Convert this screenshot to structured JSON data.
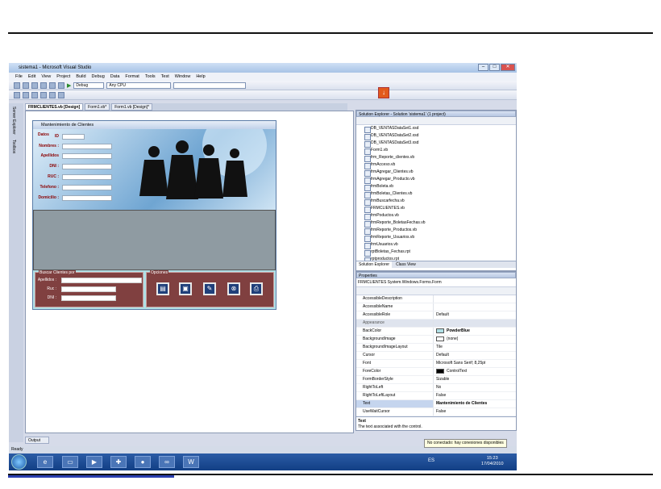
{
  "window": {
    "title": "sistema1 - Microsoft Visual Studio",
    "buttons": [
      "–",
      "□",
      "✕"
    ]
  },
  "menu": [
    "File",
    "Edit",
    "View",
    "Project",
    "Build",
    "Debug",
    "Data",
    "Format",
    "Tools",
    "Test",
    "Window",
    "Help"
  ],
  "toolbar": {
    "config": "Debug",
    "platform": "Any CPU"
  },
  "tabs": [
    "FRMCLIENTES.vb [Design]",
    "Form1.vb*",
    "Form1.vb [Design]*"
  ],
  "side_tabs": [
    "Server Explorer",
    "Toolbox"
  ],
  "form": {
    "title": "Mantenimiento de Clientes",
    "datos": "Datos",
    "fields": [
      "ID",
      "Nombres :",
      "Apellidos",
      "DNI :",
      "RUC :",
      "Telefono :",
      "Domicilio :"
    ],
    "buscar": {
      "title": "Buscar Clientes por",
      "fields": [
        "Apellidos :",
        "Ruc :",
        "DNI :"
      ]
    },
    "opciones": {
      "title": "Opciones",
      "icons": [
        "new-icon",
        "save-icon",
        "edit-icon",
        "delete-icon",
        "print-icon"
      ]
    }
  },
  "solution_explorer": {
    "title": "Solution Explorer - Solution 'sistema1' (1 project)",
    "items": [
      "DB_VENTASDataSet1.xsd",
      "DB_VENTASDataSet2.xsd",
      "DB_VENTASDataSet3.xsd",
      "Form1.vb",
      "frm_Reporte_clientes.vb",
      "frmAcceso.vb",
      "frmAgregar_Clientes.vb",
      "frmAgregar_Producto.vb",
      "frmBoleta.vb",
      "frmBoletas_Clientes.vb",
      "frmBuscarfecha.vb",
      "FRMCLIENTES.vb",
      "frmPoductos.vb",
      "frmReporte_BoletasFechas.vb",
      "frmReporte_Productos.vb",
      "frmReporte_Usuarios.vb",
      "frmUsuarios.vb",
      "rptBoletas_Fechas.rpt",
      "rptproductos.rpt"
    ],
    "tabs": [
      "Solution Explorer",
      "Class View"
    ]
  },
  "properties": {
    "title": "Properties",
    "object": "FRMCLIENTES System.Windows.Forms.Form",
    "rows": [
      {
        "n": "AccessibleDescription",
        "v": ""
      },
      {
        "n": "AccessibleName",
        "v": ""
      },
      {
        "n": "AccessibleRole",
        "v": "Default"
      },
      {
        "n": "Appearance",
        "v": "",
        "cat": true
      },
      {
        "n": "BackColor",
        "v": "PowderBlue",
        "sw": "#b0e0e6"
      },
      {
        "n": "BackgroundImage",
        "v": "(none)",
        "sw": "#ffffff"
      },
      {
        "n": "BackgroundImageLayout",
        "v": "Tile"
      },
      {
        "n": "Cursor",
        "v": "Default"
      },
      {
        "n": "Font",
        "v": "Microsoft Sans Serif; 8,25pt"
      },
      {
        "n": "ForeColor",
        "v": "ControlText",
        "sw": "#000000"
      },
      {
        "n": "FormBorderStyle",
        "v": "Sizable"
      },
      {
        "n": "RightToLeft",
        "v": "No"
      },
      {
        "n": "RightToLeftLayout",
        "v": "False"
      },
      {
        "n": "Text",
        "v": "Mantenimiento de Clientes",
        "sel": true
      },
      {
        "n": "UseWaitCursor",
        "v": "False"
      }
    ],
    "desc_title": "Text",
    "desc": "The text associated with the control."
  },
  "output_tab": "Output",
  "status": {
    "ready": "Ready",
    "tooltip": "No conectado: hay conexiones disponibles"
  },
  "clock": {
    "time": "15:23",
    "date": "17/04/2010"
  },
  "tray": "ES"
}
